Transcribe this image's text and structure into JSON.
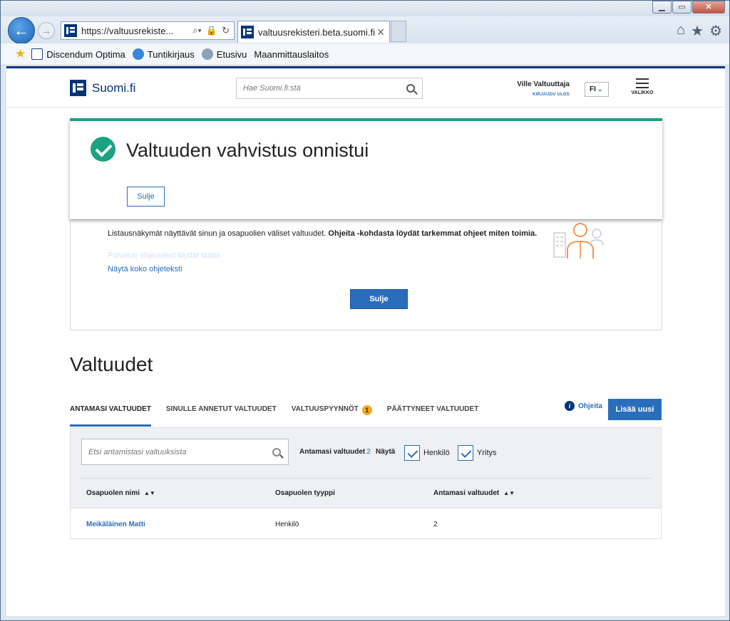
{
  "browser": {
    "address": "https://valtuusrekiste...",
    "tab_title": "valtuusrekisteri.beta.suomi.fi",
    "favorites": [
      "Discendum Optima",
      "Tuntikirjaus",
      "Etusivu",
      "Maanmittauslaitos"
    ]
  },
  "header": {
    "logo": "Suomi.fi",
    "search_placeholder": "Hae Suomi.fi:stä",
    "user_name": "Ville Valtuuttaja",
    "logout": "KIRJAUDU ULOS",
    "lang": "FI",
    "menu_label": "VALIKKO"
  },
  "dialog": {
    "title": "Valtuuden vahvistus onnistui",
    "close": "Sulje"
  },
  "info": {
    "text_normal": "Listausnäkymät näyttävät sinun ja osapuolien väliset valtuudet. ",
    "text_bold": "Ohjeita -kohdasta löydät tarkemmat ohjeet miten toimia.",
    "faded_link": "Palvelun ohjevideot löydät täältä",
    "show_all": "Näytä koko ohjeteksti",
    "close": "Sulje"
  },
  "main": {
    "title": "Valtuudet",
    "tabs": [
      {
        "label": "ANTAMASI VALTUUDET"
      },
      {
        "label": "SINULLE ANNETUT VALTUUDET"
      },
      {
        "label": "VALTUUSPYYNNÖT",
        "badge": "1"
      },
      {
        "label": "PÄÄTTYNEET VALTUUDET"
      }
    ],
    "help": "Ohjeita",
    "add_new": "Lisää uusi",
    "filter": {
      "search_placeholder": "Etsi antamistasi valtuuksista",
      "count_label": "Antamasi valtuudet",
      "count": "2",
      "show_label": "Näytä",
      "person": "Henkilö",
      "company": "Yritys"
    },
    "table": {
      "headers": [
        "Osapuolen nimi",
        "Osapuolen tyyppi",
        "Antamasi valtuudet"
      ],
      "rows": [
        {
          "name": "Meikäläinen Matti",
          "type": "Henkilö",
          "count": "2"
        }
      ]
    }
  },
  "colors": {
    "brand": "#003479",
    "link": "#2a6ebb",
    "success": "#1aa283",
    "badge": "#f3a81c"
  }
}
